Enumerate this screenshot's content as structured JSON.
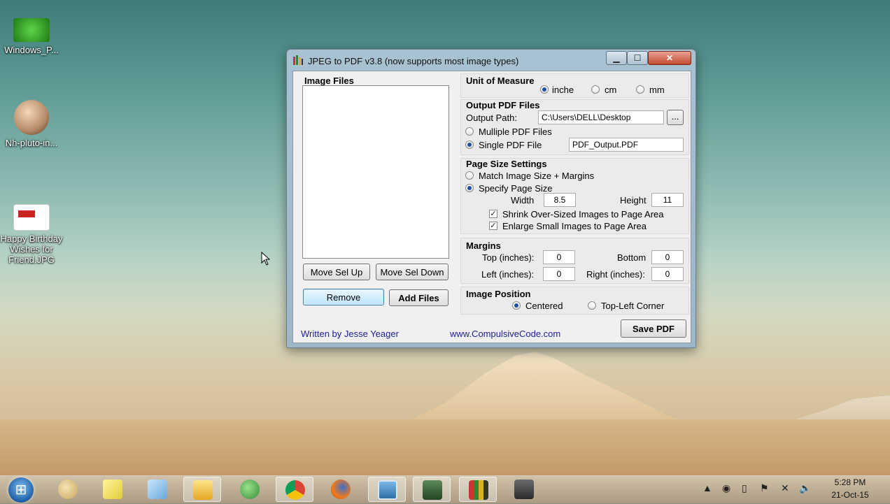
{
  "desktop": {
    "icons": [
      {
        "label": "Windows_P..."
      },
      {
        "label": "Nh-pluto-in..."
      },
      {
        "label": "Happy Birthday Wishes for Friend.JPG"
      }
    ]
  },
  "window": {
    "title": "JPEG to PDF  v3.8   (now supports most image types)",
    "controls": {
      "minimize": "▁",
      "maximize": "☐",
      "close": "✕"
    }
  },
  "image_files": {
    "label": "Image Files",
    "move_up": "Move Sel Up",
    "move_down": "Move Sel Down",
    "remove": "Remove",
    "add": "Add Files"
  },
  "unit_of_measure": {
    "label": "Unit of Measure",
    "options": [
      "inche",
      "cm",
      "mm"
    ],
    "selected": "inche"
  },
  "output": {
    "label": "Output PDF Files",
    "path_label": "Output Path:",
    "path_value": "C:\\Users\\DELL\\Desktop",
    "browse": "...",
    "multiple_label": "Mulliple PDF Files",
    "single_label": "Single PDF File",
    "single_name": "PDF_Output.PDF",
    "selected": "single"
  },
  "page_size": {
    "label": "Page Size Settings",
    "match_label": "Match Image Size + Margins",
    "specify_label": "Specify Page Size",
    "selected": "specify",
    "width_label": "Width",
    "width_value": "8.5",
    "height_label": "Height",
    "height_value": "11",
    "shrink_label": "Shrink Over-Sized Images to Page Area",
    "shrink_checked": true,
    "enlarge_label": "Enlarge Small Images to Page Area",
    "enlarge_checked": true
  },
  "margins": {
    "label": "Margins",
    "top_label": "Top (inches):",
    "top_value": "0",
    "bottom_label": "Bottom",
    "bottom_value": "0",
    "left_label": "Left (inches):",
    "left_value": "0",
    "right_label": "Right (inches):",
    "right_value": "0"
  },
  "image_position": {
    "label": "Image Position",
    "centered": "Centered",
    "top_left": "Top-Left Corner",
    "selected": "centered"
  },
  "footer": {
    "author": "Written by Jesse Yeager",
    "website": "www.CompulsiveCode.com",
    "save": "Save PDF"
  },
  "taskbar": {
    "items": [
      "paint",
      "sticky-notes",
      "notepad",
      "file-explorer",
      "network",
      "chrome",
      "firefox",
      "photo-viewer",
      "excel",
      "jpeg-to-pdf",
      "app"
    ],
    "clock_time": "5:28 PM",
    "clock_date": "21-Oct-15"
  }
}
